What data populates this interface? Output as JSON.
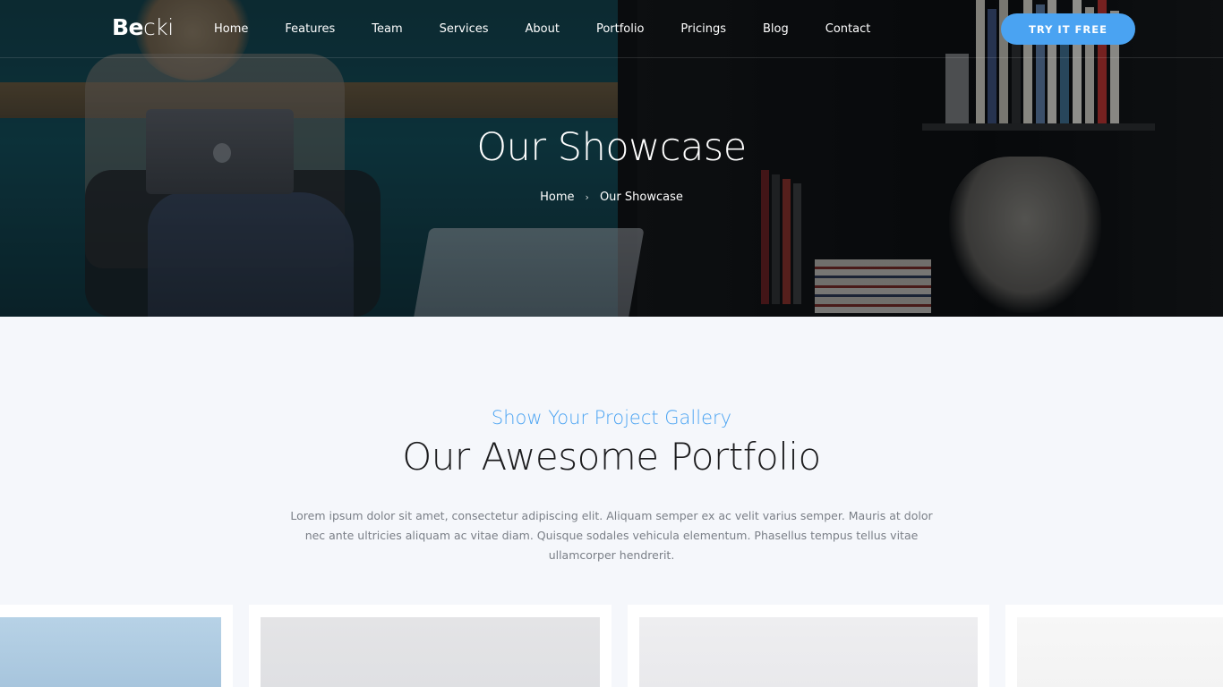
{
  "nav": {
    "logo_bold": "Be",
    "logo_light": "cki",
    "items": [
      "Home",
      "Features",
      "Team",
      "Services",
      "About",
      "Portfolio",
      "Pricings",
      "Blog",
      "Contact"
    ],
    "cta": "TRY IT FREE"
  },
  "hero": {
    "title": "Our Showcase",
    "breadcrumb_home": "Home",
    "breadcrumb_sep": "›",
    "breadcrumb_current": "Our Showcase"
  },
  "section": {
    "subtitle": "Show Your Project Gallery",
    "title": "Our Awesome Portfolio",
    "description": "Lorem ipsum dolor sit amet, consectetur adipiscing elit. Aliquam semper ex ac velit varius semper. Mauris at dolor nec ante ultricies aliquam ac vitae diam. Quisque sodales vehicula elementum. Phasellus tempus tellus vitae ullamcorper hendrerit."
  },
  "colors": {
    "accent": "#4aa3f2",
    "background": "#f5f7fb"
  }
}
